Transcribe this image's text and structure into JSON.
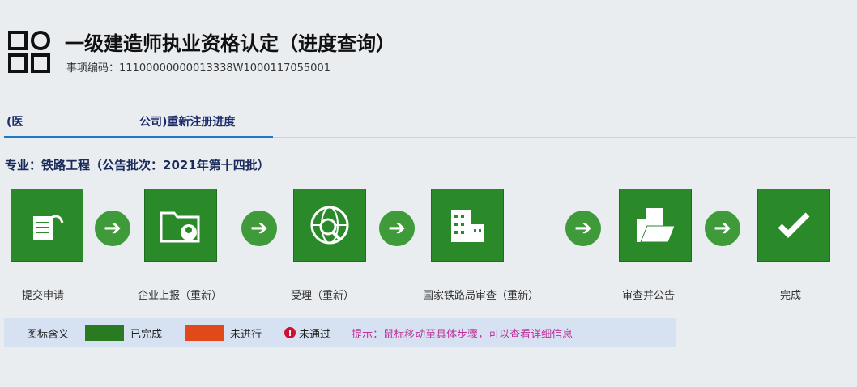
{
  "header": {
    "title": "一级建造师执业资格认定（进度查询）",
    "code_label": "事项编码：",
    "code": "11100000000013338W1000117055001"
  },
  "tab": {
    "left": "(医",
    "right": "公司)重新注册进度"
  },
  "major": "专业：铁路工程（公告批次：2021年第十四批）",
  "steps": [
    {
      "label": "提交申请",
      "icon": "submit-document-icon"
    },
    {
      "label": "企业上报（重新）",
      "icon": "folder-user-icon"
    },
    {
      "label": "受理（重新）",
      "icon": "globe-search-icon"
    },
    {
      "label": "国家铁路局审查（重新）",
      "icon": "building-icon"
    },
    {
      "label": "审查并公告",
      "icon": "folder-document-icon"
    },
    {
      "label": "完成",
      "icon": "checkmark-icon"
    }
  ],
  "legend": {
    "title": "图标含义",
    "done": "已完成",
    "pending": "未进行",
    "failed": "未通过",
    "hint": "提示：鼠标移动至具体步骤，可以查看详细信息"
  },
  "colors": {
    "done": "#2a7a22",
    "pending": "#e04a1a",
    "failed": "#d01030",
    "hint": "#c0309a"
  }
}
